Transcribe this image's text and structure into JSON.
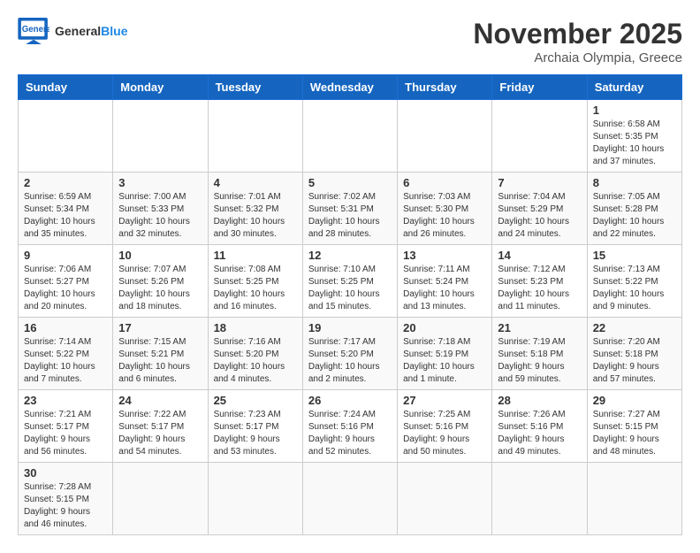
{
  "header": {
    "logo_general": "General",
    "logo_blue": "Blue",
    "month_title": "November 2025",
    "location": "Archaia Olympia, Greece"
  },
  "weekdays": [
    "Sunday",
    "Monday",
    "Tuesday",
    "Wednesday",
    "Thursday",
    "Friday",
    "Saturday"
  ],
  "weeks": [
    [
      {
        "day": "",
        "info": ""
      },
      {
        "day": "",
        "info": ""
      },
      {
        "day": "",
        "info": ""
      },
      {
        "day": "",
        "info": ""
      },
      {
        "day": "",
        "info": ""
      },
      {
        "day": "",
        "info": ""
      },
      {
        "day": "1",
        "info": "Sunrise: 6:58 AM\nSunset: 5:35 PM\nDaylight: 10 hours and 37 minutes."
      }
    ],
    [
      {
        "day": "2",
        "info": "Sunrise: 6:59 AM\nSunset: 5:34 PM\nDaylight: 10 hours and 35 minutes."
      },
      {
        "day": "3",
        "info": "Sunrise: 7:00 AM\nSunset: 5:33 PM\nDaylight: 10 hours and 32 minutes."
      },
      {
        "day": "4",
        "info": "Sunrise: 7:01 AM\nSunset: 5:32 PM\nDaylight: 10 hours and 30 minutes."
      },
      {
        "day": "5",
        "info": "Sunrise: 7:02 AM\nSunset: 5:31 PM\nDaylight: 10 hours and 28 minutes."
      },
      {
        "day": "6",
        "info": "Sunrise: 7:03 AM\nSunset: 5:30 PM\nDaylight: 10 hours and 26 minutes."
      },
      {
        "day": "7",
        "info": "Sunrise: 7:04 AM\nSunset: 5:29 PM\nDaylight: 10 hours and 24 minutes."
      },
      {
        "day": "8",
        "info": "Sunrise: 7:05 AM\nSunset: 5:28 PM\nDaylight: 10 hours and 22 minutes."
      }
    ],
    [
      {
        "day": "9",
        "info": "Sunrise: 7:06 AM\nSunset: 5:27 PM\nDaylight: 10 hours and 20 minutes."
      },
      {
        "day": "10",
        "info": "Sunrise: 7:07 AM\nSunset: 5:26 PM\nDaylight: 10 hours and 18 minutes."
      },
      {
        "day": "11",
        "info": "Sunrise: 7:08 AM\nSunset: 5:25 PM\nDaylight: 10 hours and 16 minutes."
      },
      {
        "day": "12",
        "info": "Sunrise: 7:10 AM\nSunset: 5:25 PM\nDaylight: 10 hours and 15 minutes."
      },
      {
        "day": "13",
        "info": "Sunrise: 7:11 AM\nSunset: 5:24 PM\nDaylight: 10 hours and 13 minutes."
      },
      {
        "day": "14",
        "info": "Sunrise: 7:12 AM\nSunset: 5:23 PM\nDaylight: 10 hours and 11 minutes."
      },
      {
        "day": "15",
        "info": "Sunrise: 7:13 AM\nSunset: 5:22 PM\nDaylight: 10 hours and 9 minutes."
      }
    ],
    [
      {
        "day": "16",
        "info": "Sunrise: 7:14 AM\nSunset: 5:22 PM\nDaylight: 10 hours and 7 minutes."
      },
      {
        "day": "17",
        "info": "Sunrise: 7:15 AM\nSunset: 5:21 PM\nDaylight: 10 hours and 6 minutes."
      },
      {
        "day": "18",
        "info": "Sunrise: 7:16 AM\nSunset: 5:20 PM\nDaylight: 10 hours and 4 minutes."
      },
      {
        "day": "19",
        "info": "Sunrise: 7:17 AM\nSunset: 5:20 PM\nDaylight: 10 hours and 2 minutes."
      },
      {
        "day": "20",
        "info": "Sunrise: 7:18 AM\nSunset: 5:19 PM\nDaylight: 10 hours and 1 minute."
      },
      {
        "day": "21",
        "info": "Sunrise: 7:19 AM\nSunset: 5:18 PM\nDaylight: 9 hours and 59 minutes."
      },
      {
        "day": "22",
        "info": "Sunrise: 7:20 AM\nSunset: 5:18 PM\nDaylight: 9 hours and 57 minutes."
      }
    ],
    [
      {
        "day": "23",
        "info": "Sunrise: 7:21 AM\nSunset: 5:17 PM\nDaylight: 9 hours and 56 minutes."
      },
      {
        "day": "24",
        "info": "Sunrise: 7:22 AM\nSunset: 5:17 PM\nDaylight: 9 hours and 54 minutes."
      },
      {
        "day": "25",
        "info": "Sunrise: 7:23 AM\nSunset: 5:17 PM\nDaylight: 9 hours and 53 minutes."
      },
      {
        "day": "26",
        "info": "Sunrise: 7:24 AM\nSunset: 5:16 PM\nDaylight: 9 hours and 52 minutes."
      },
      {
        "day": "27",
        "info": "Sunrise: 7:25 AM\nSunset: 5:16 PM\nDaylight: 9 hours and 50 minutes."
      },
      {
        "day": "28",
        "info": "Sunrise: 7:26 AM\nSunset: 5:16 PM\nDaylight: 9 hours and 49 minutes."
      },
      {
        "day": "29",
        "info": "Sunrise: 7:27 AM\nSunset: 5:15 PM\nDaylight: 9 hours and 48 minutes."
      }
    ],
    [
      {
        "day": "30",
        "info": "Sunrise: 7:28 AM\nSunset: 5:15 PM\nDaylight: 9 hours and 46 minutes."
      },
      {
        "day": "",
        "info": ""
      },
      {
        "day": "",
        "info": ""
      },
      {
        "day": "",
        "info": ""
      },
      {
        "day": "",
        "info": ""
      },
      {
        "day": "",
        "info": ""
      },
      {
        "day": "",
        "info": ""
      }
    ]
  ]
}
